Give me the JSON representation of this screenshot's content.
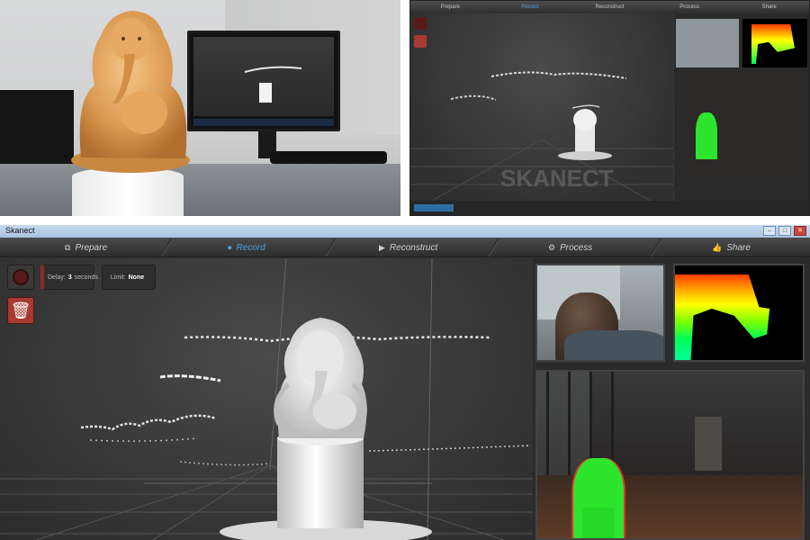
{
  "main_window": {
    "title": "Skanect",
    "tabs": [
      {
        "label": "Prepare",
        "icon": "prepare-icon",
        "active": false
      },
      {
        "label": "Record",
        "icon": "record-icon",
        "active": true
      },
      {
        "label": "Reconstruct",
        "icon": "reconstruct-icon",
        "active": false
      },
      {
        "label": "Process",
        "icon": "process-icon",
        "active": false
      },
      {
        "label": "Share",
        "icon": "share-icon",
        "active": false
      }
    ],
    "controls": {
      "delay_label": "Delay:",
      "delay_value": "3",
      "delay_unit": "seconds",
      "limit_label": "Limit:",
      "limit_value": "None"
    },
    "colors": {
      "accent": "#4aa3df",
      "record_red": "#8c2a2a",
      "delete_red": "#a83a32",
      "depth_green": "#2ee52e"
    }
  },
  "small_window": {
    "tabs": [
      "Prepare",
      "Record",
      "Reconstruct",
      "Process",
      "Share"
    ],
    "active_tab": "Record",
    "watermark": "SKANECT"
  }
}
